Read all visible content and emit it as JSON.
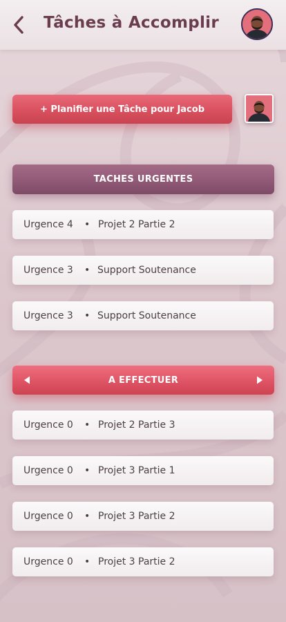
{
  "header": {
    "back_icon": "chevron-left-icon",
    "title": "Tâches à Accomplir",
    "avatar": "user-avatar"
  },
  "plan_button": {
    "label": "+ Planifier une Tâche pour Jacob"
  },
  "urgent_section": {
    "title": "TACHES URGENTES",
    "tasks": [
      {
        "urgency": "Urgence 4",
        "separator": "•",
        "name": "Projet 2 Partie 2"
      },
      {
        "urgency": "Urgence 3",
        "separator": "•",
        "name": "Support Soutenance"
      },
      {
        "urgency": "Urgence 3",
        "separator": "•",
        "name": "Support Soutenance"
      }
    ]
  },
  "todo_section": {
    "title": "A EFFECTUER",
    "prev_icon": "triangle-left-icon",
    "next_icon": "triangle-right-icon",
    "tasks": [
      {
        "urgency": "Urgence 0",
        "separator": "•",
        "name": "Projet 2 Partie 3"
      },
      {
        "urgency": "Urgence 0",
        "separator": "•",
        "name": "Projet 3 Partie 1"
      },
      {
        "urgency": "Urgence 0",
        "separator": "•",
        "name": "Projet 3 Partie 2"
      },
      {
        "urgency": "Urgence 0",
        "separator": "•",
        "name": "Projet 3 Partie 2"
      }
    ]
  },
  "colors": {
    "primary_red": "#de5465",
    "mauve": "#8f5875",
    "title_color": "#6a3d4e",
    "avatar_ring": "#3c2f57"
  }
}
